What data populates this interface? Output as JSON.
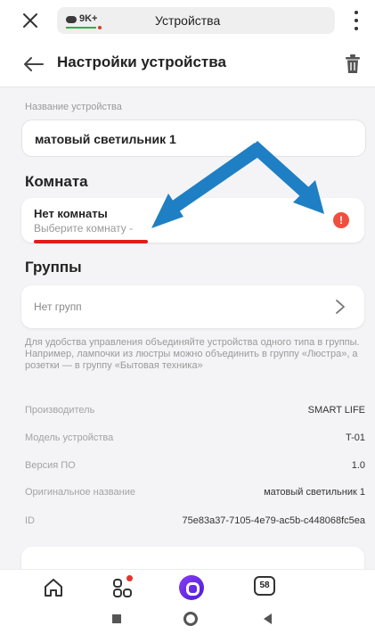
{
  "browser": {
    "tab_count": "9K+",
    "tab_title": "Устройства"
  },
  "header": {
    "title": "Настройки устройства"
  },
  "device_name": {
    "label": "Название устройства",
    "value": "матовый светильник 1"
  },
  "room": {
    "section_title": "Комната",
    "value": "Нет комнаты",
    "hint": "Выберите комнату -",
    "warning_symbol": "!"
  },
  "groups": {
    "section_title": "Группы",
    "value": "Нет групп",
    "description": "Для удобства управления объединяйте устройства одного типа в группы. Например, лампочки из люстры можно объединить в группу «Люстра», а розетки — в группу «Бытовая техника»"
  },
  "info": [
    {
      "key": "Производитель",
      "value": "SMART LIFE"
    },
    {
      "key": "Модель устройства",
      "value": "T-01"
    },
    {
      "key": "Версия ПО",
      "value": "1.0"
    },
    {
      "key": "Оригинальное название",
      "value": "матовый светильник 1"
    },
    {
      "key": "ID",
      "value": "75e83a37-7105-4e79-ac5b-c448068fc5ea"
    }
  ],
  "bottom_nav": {
    "counter": "58"
  },
  "colors": {
    "accent_arrow": "#1f7fc4",
    "warning": "#f04e3e",
    "underline": "#e31b1b",
    "alice": "#6a2de8"
  },
  "icons": [
    "close-icon",
    "more-vert-icon",
    "back-arrow-icon",
    "trash-icon",
    "warning-icon",
    "chevron-right-icon",
    "home-icon",
    "apps-icon",
    "alice-icon",
    "tabs-counter-icon"
  ]
}
